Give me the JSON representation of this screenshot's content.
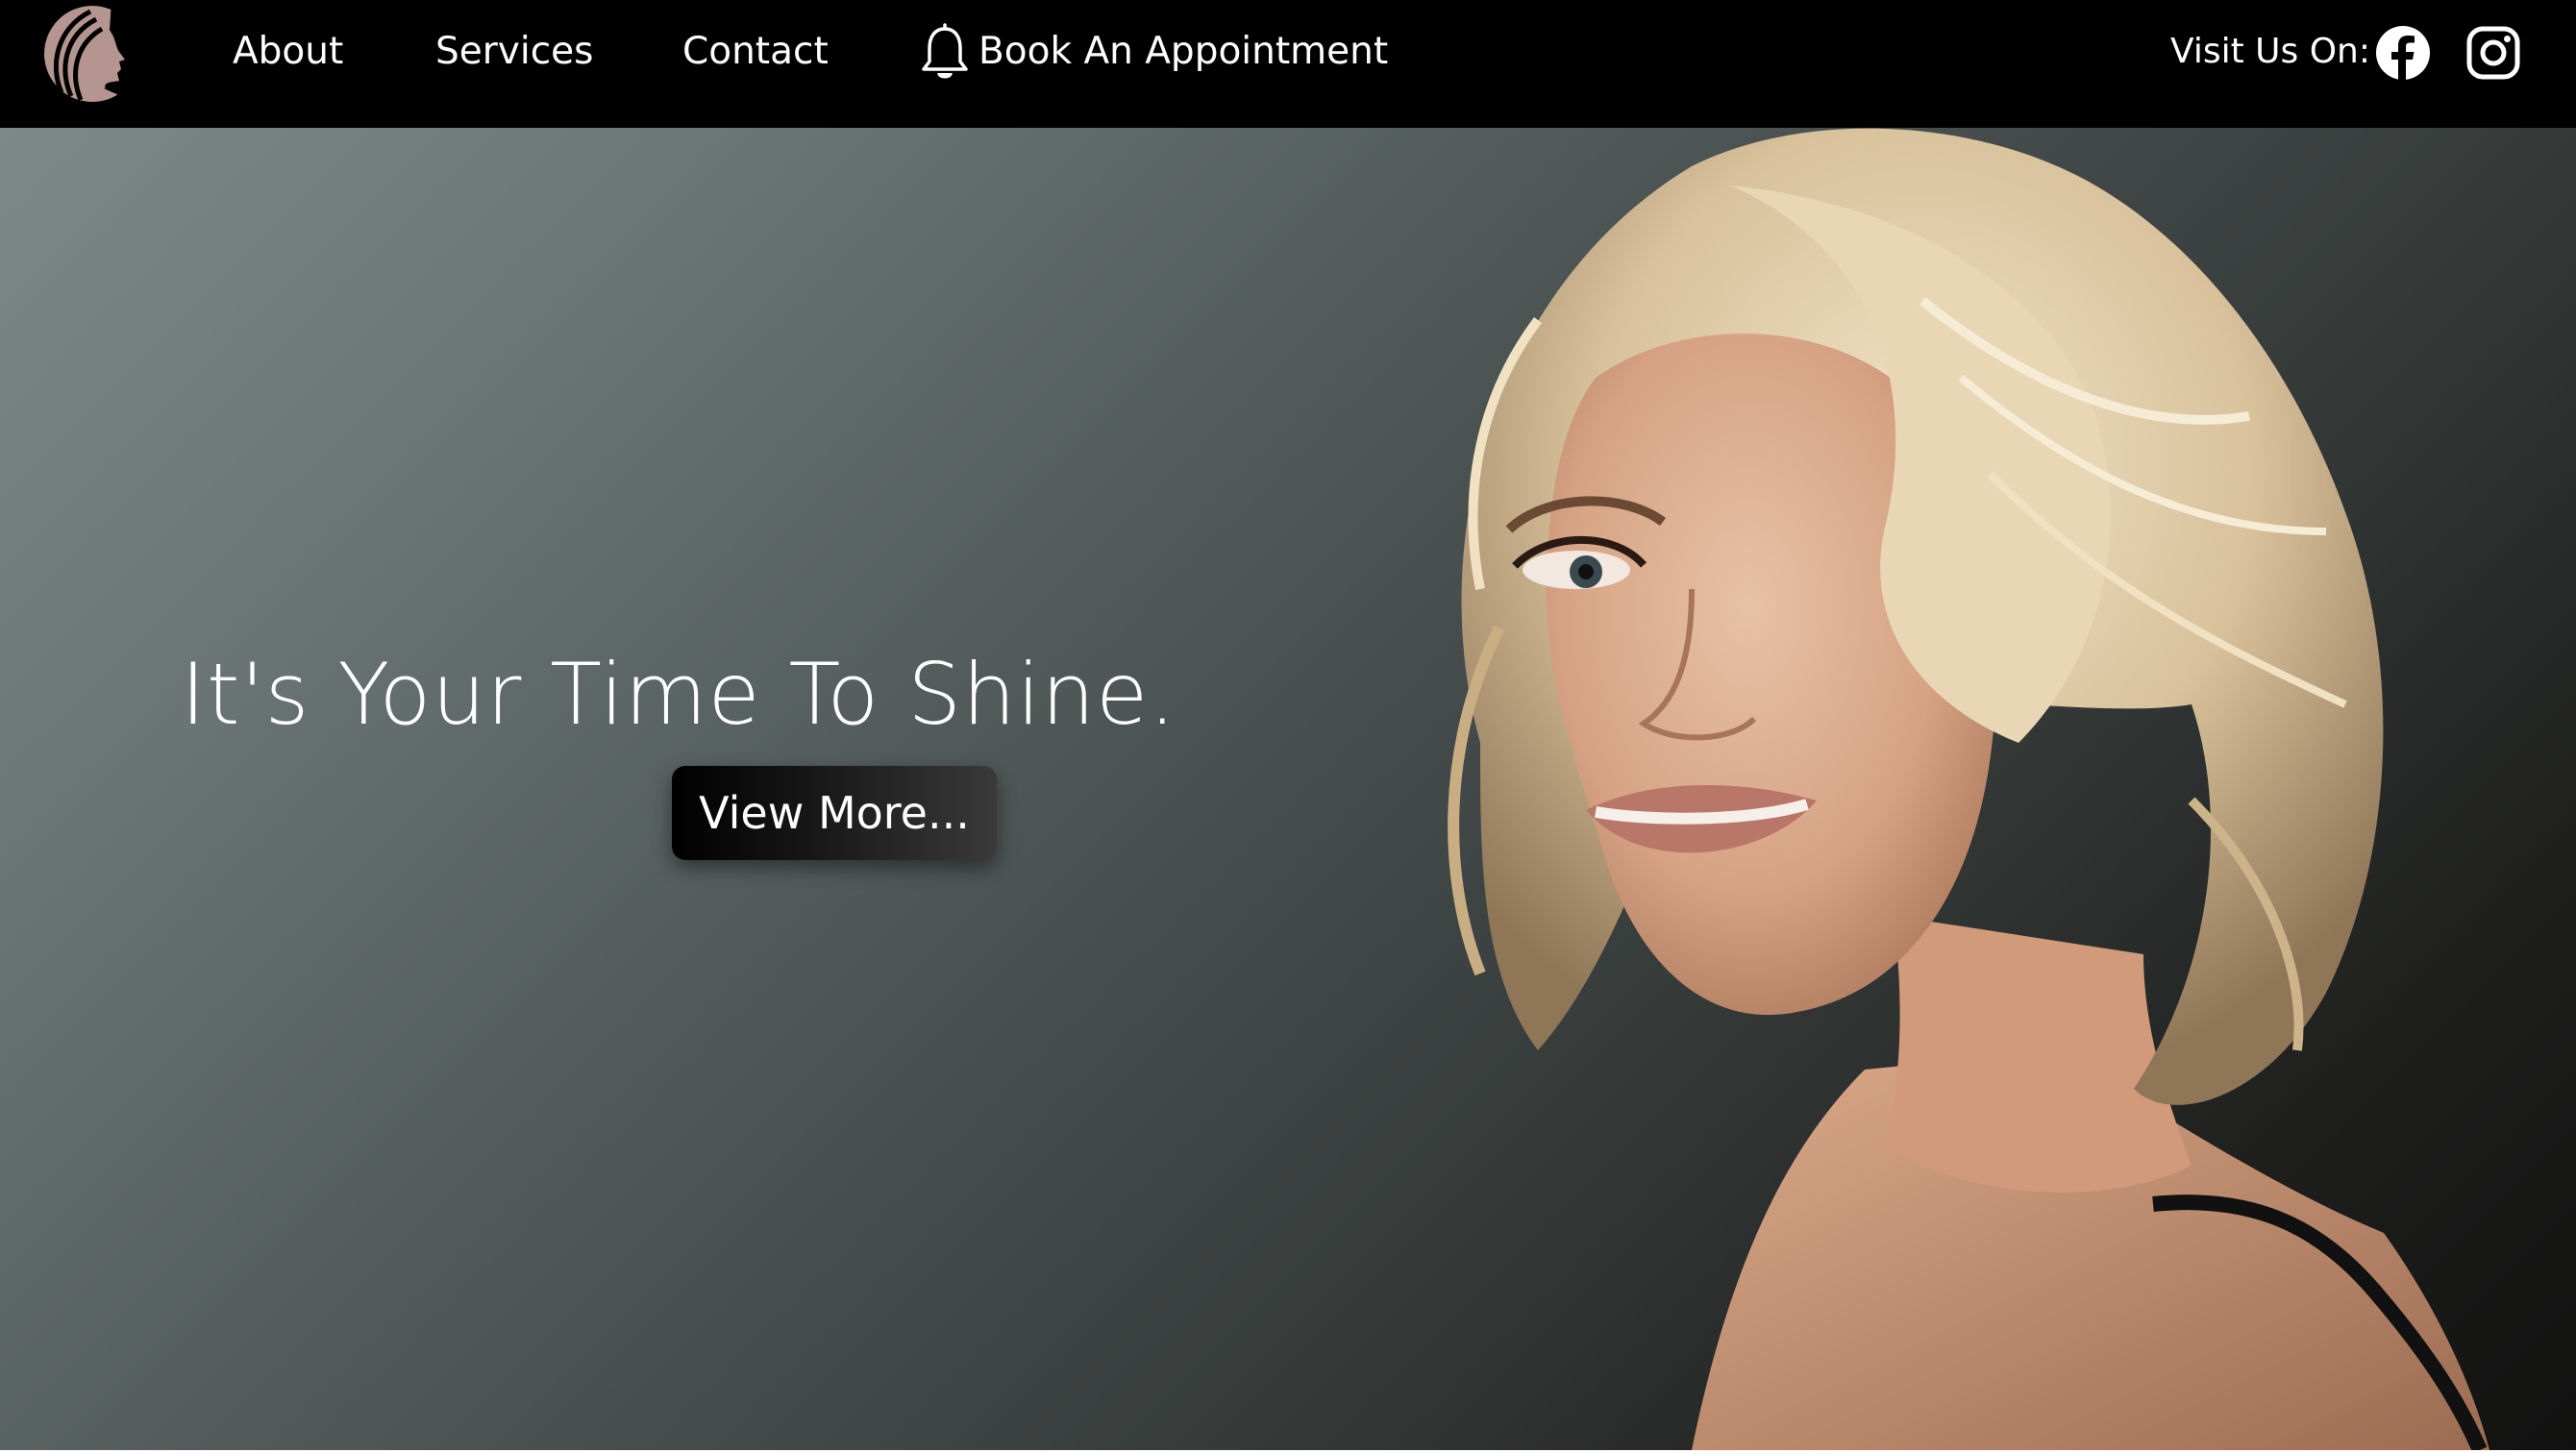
{
  "nav": {
    "logo_icon": "woman-profile-logo-icon",
    "links": [
      {
        "label": "About"
      },
      {
        "label": "Services"
      },
      {
        "label": "Contact"
      }
    ],
    "book": {
      "label": "Book An Appointment",
      "icon": "bell-icon"
    },
    "visit_label": "Visit Us On:",
    "social": [
      {
        "icon": "facebook-icon"
      },
      {
        "icon": "instagram-icon"
      }
    ]
  },
  "hero": {
    "heading": "It's Your Time To Shine.",
    "button_label": "View More...",
    "image": "woman-with-blonde-wavy-hair-photo"
  },
  "colors": {
    "nav_background": "#000000",
    "logo": "#b59590",
    "text": "#ffffff",
    "hero_gradient_start": "#7d8889",
    "hero_gradient_end": "#111110",
    "button_background": "#000000"
  }
}
